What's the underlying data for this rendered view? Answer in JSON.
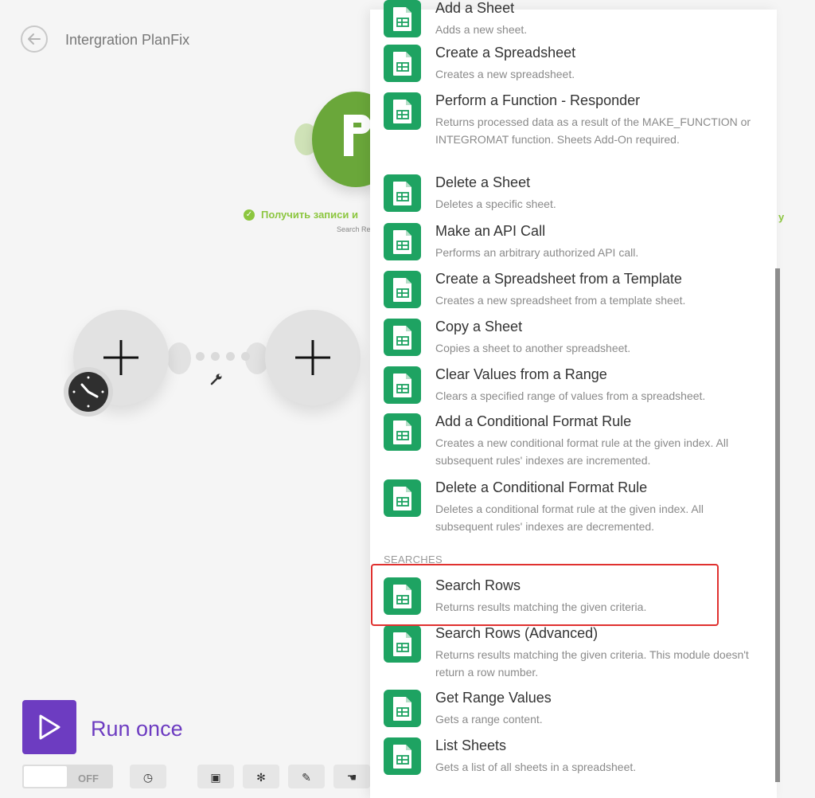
{
  "header": {
    "scenario_title": "Intergration PlanFix"
  },
  "canvas": {
    "planfix_module": {
      "label": "Получить записи и",
      "sublabel": "Search Re",
      "right_label": "y"
    }
  },
  "controls": {
    "run_once_label": "Run once",
    "toggle_label": "OFF"
  },
  "panel": {
    "items": [
      {
        "name": "Add a Sheet",
        "desc": "Adds a new sheet."
      },
      {
        "name": "Create a Spreadsheet",
        "desc": "Creates a new spreadsheet."
      },
      {
        "name": "Perform a Function - Responder",
        "desc": "Returns processed data as a result of the MAKE_FUNCTION or INTEGROMAT function. Sheets Add-On required."
      },
      {
        "name": "Delete a Sheet",
        "desc": "Deletes a specific sheet."
      },
      {
        "name": "Make an API Call",
        "desc": "Performs an arbitrary authorized API call."
      },
      {
        "name": "Create a Spreadsheet from a Template",
        "desc": "Creates a new spreadsheet from a template sheet."
      },
      {
        "name": "Copy a Sheet",
        "desc": "Copies a sheet to another spreadsheet."
      },
      {
        "name": "Clear Values from a Range",
        "desc": "Clears a specified range of values from a spreadsheet."
      },
      {
        "name": "Add a Conditional Format Rule",
        "desc": "Creates a new conditional format rule at the given index. All subsequent rules' indexes are incremented."
      },
      {
        "name": "Delete a Conditional Format Rule",
        "desc": "Deletes a conditional format rule at the given index. All subsequent rules' indexes are decremented."
      }
    ],
    "searches_heading": "SEARCHES",
    "search_items": [
      {
        "name": "Search Rows",
        "desc": "Returns results matching the given criteria."
      },
      {
        "name": "Search Rows (Advanced)",
        "desc": "Returns results matching the given criteria. This module doesn't return a row number."
      },
      {
        "name": "Get Range Values",
        "desc": "Gets a range content."
      },
      {
        "name": "List Sheets",
        "desc": "Gets a list of all sheets in a spreadsheet."
      }
    ]
  },
  "colors": {
    "sheets_icon_bg": "#1ea362",
    "run_button": "#6d3cc1",
    "highlight_border": "#e0312f",
    "planfix_green": "#6aa73a"
  }
}
